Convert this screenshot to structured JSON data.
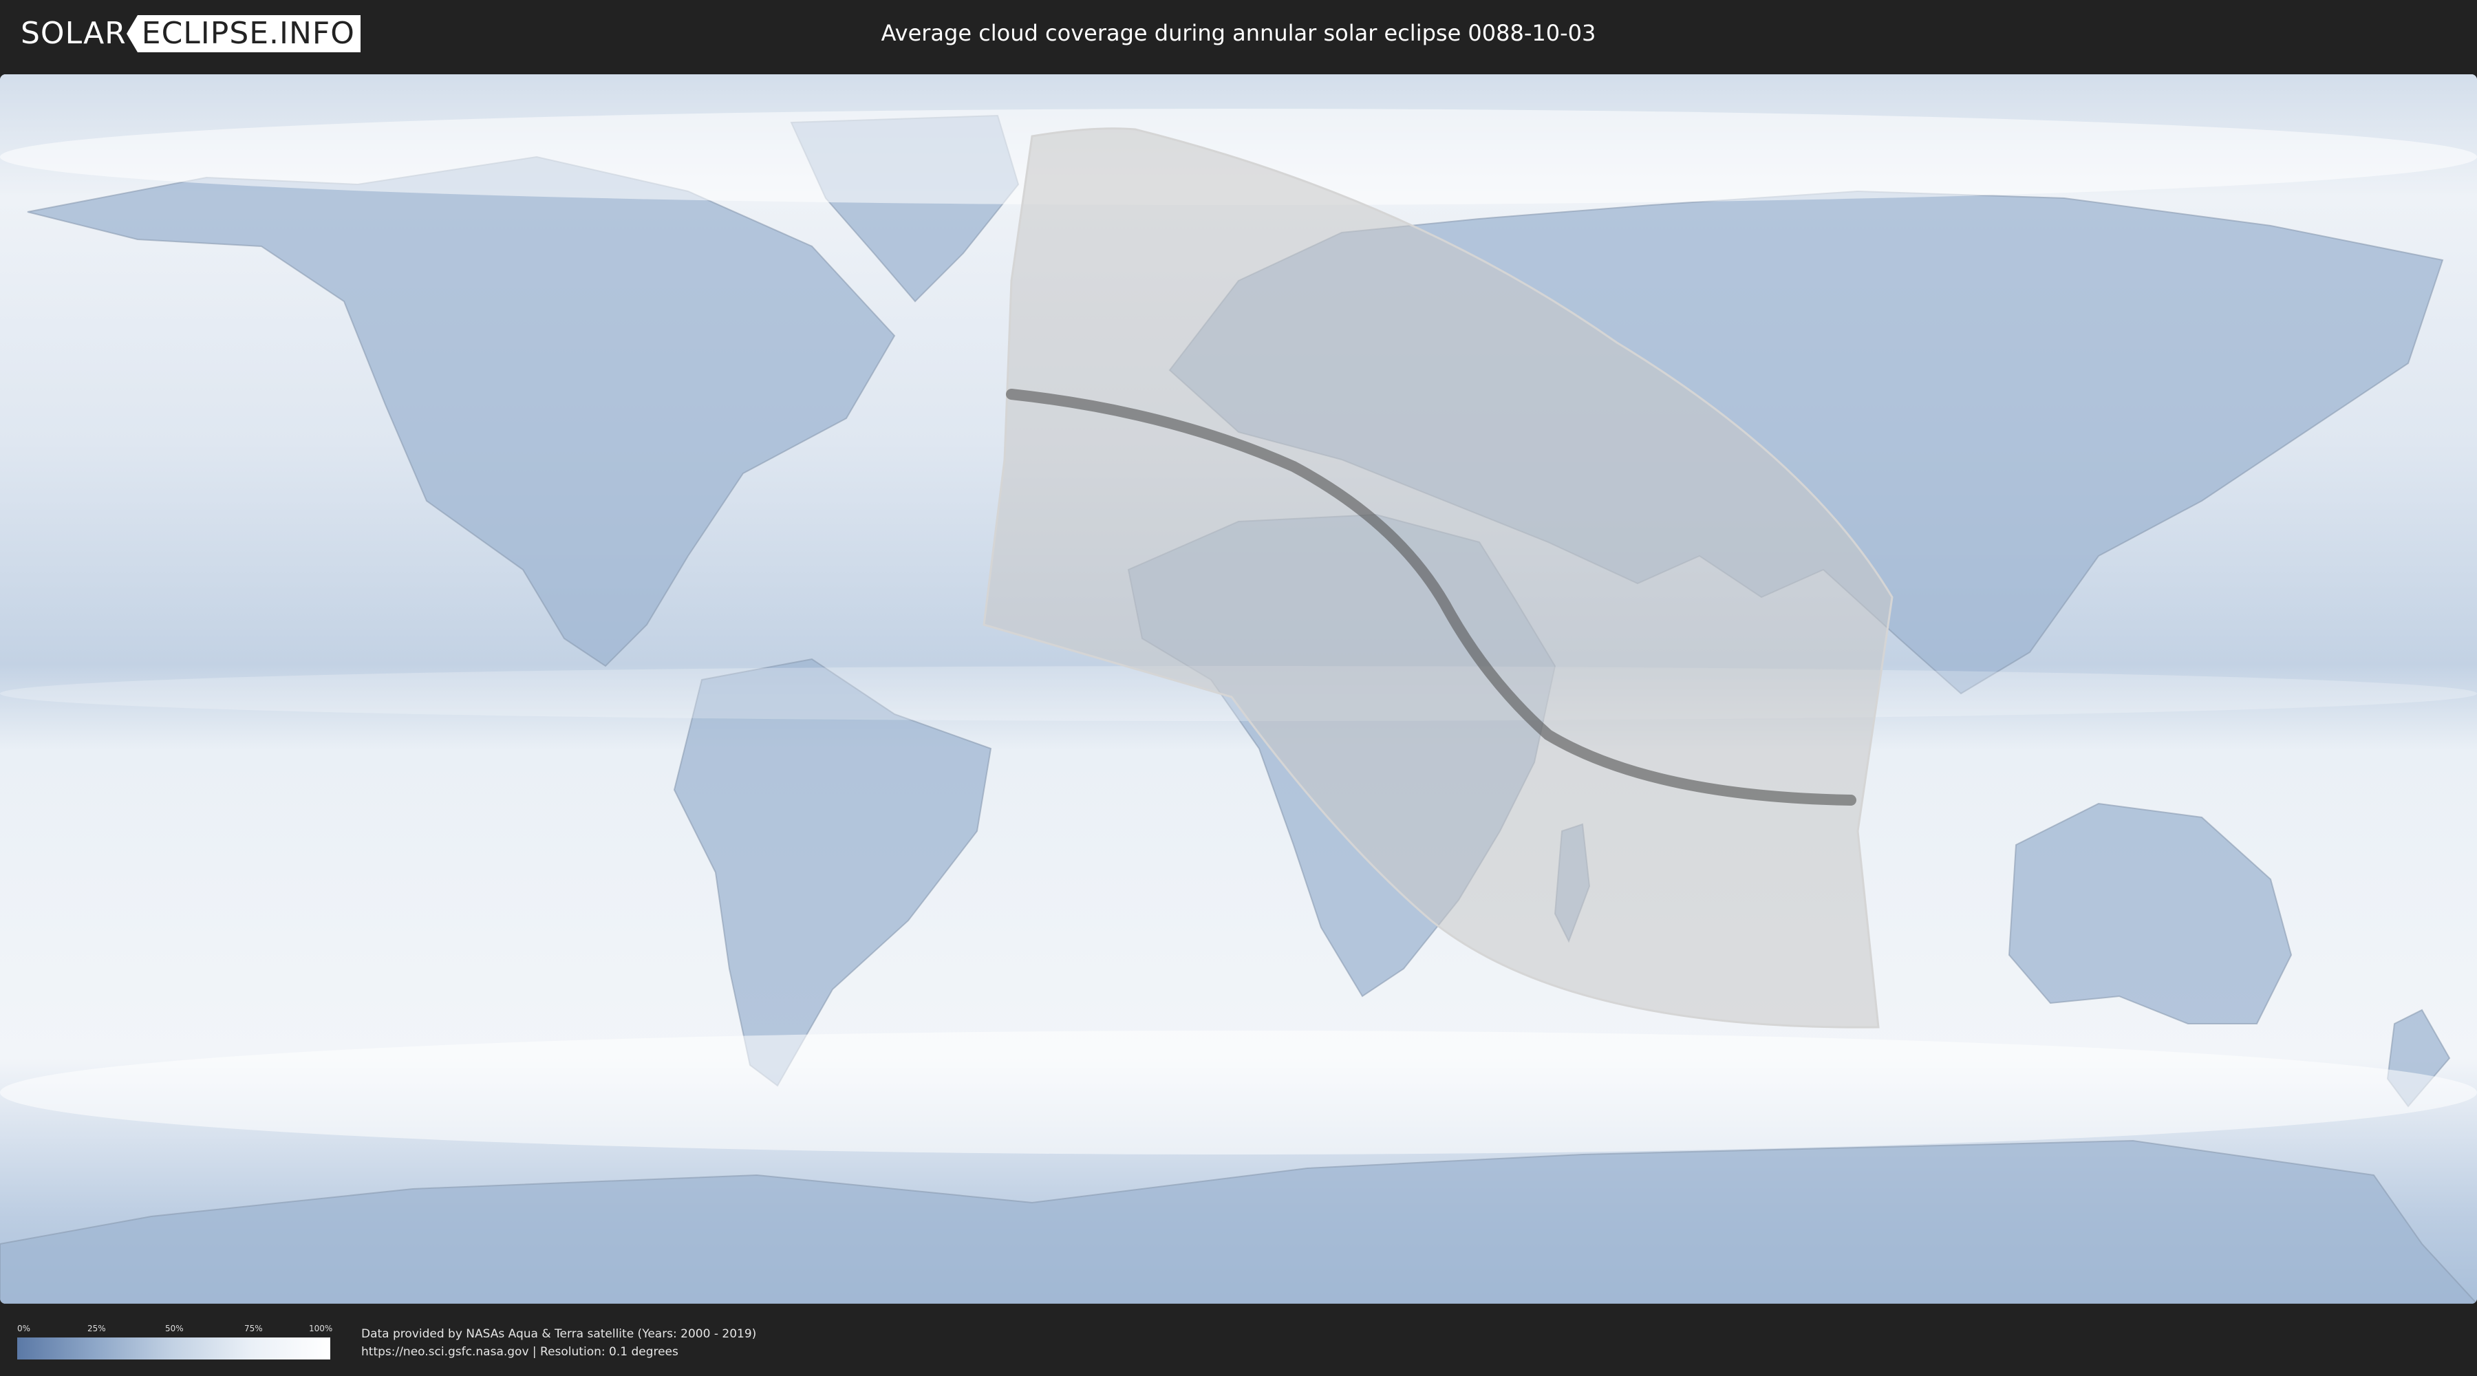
{
  "header": {
    "logo_left": "SOLAR",
    "logo_right": "ECLIPSE.INFO",
    "title": "Average cloud coverage during annular solar eclipse 0088-10-03"
  },
  "legend": {
    "ticks": [
      "0%",
      "25%",
      "50%",
      "75%",
      "100%"
    ],
    "color_low": "#5b79a6",
    "color_high": "#ffffff"
  },
  "footer": {
    "line1": "Data provided by NASAs Aqua & Terra satellite (Years: 2000 - 2019)",
    "line2": "https://neo.sci.gsfc.nasa.gov | Resolution: 0.1 degrees"
  },
  "colors": {
    "background": "#222222",
    "cloud_high": "#ffffff",
    "cloud_low": "#5b79a6",
    "eclipse_overlay": "#c8c8c8",
    "central_path": "#555555"
  }
}
